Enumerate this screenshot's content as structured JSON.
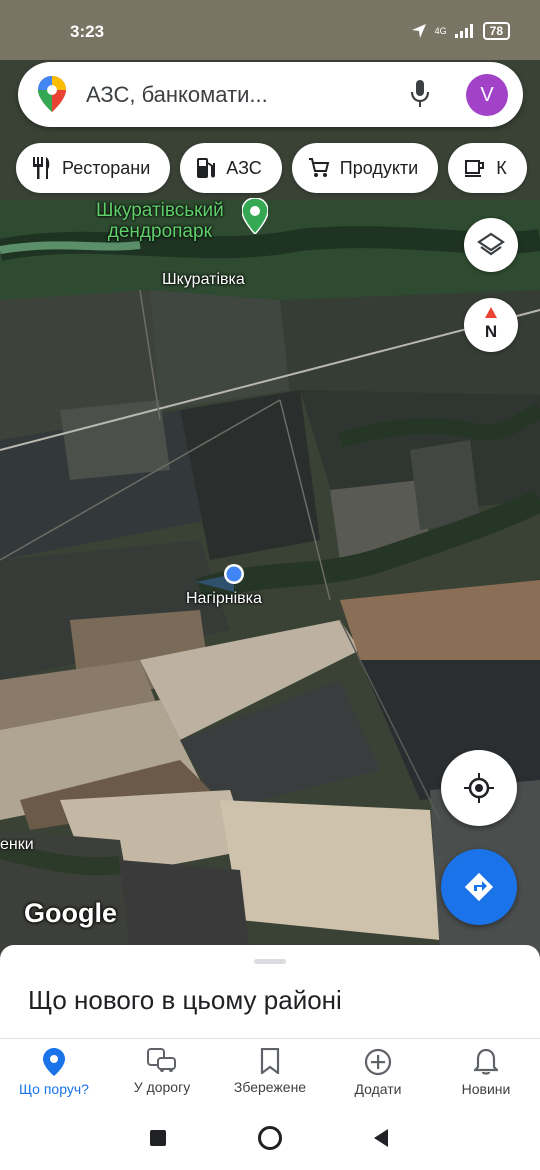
{
  "status": {
    "time": "3:23",
    "network": "4G",
    "battery": "78"
  },
  "search": {
    "placeholder": "АЗС, банкомати...",
    "avatar_letter": "V"
  },
  "chips": [
    {
      "label": "Ресторани",
      "icon": "restaurant-icon"
    },
    {
      "label": "АЗС",
      "icon": "gas-station-icon"
    },
    {
      "label": "Продукти",
      "icon": "shopping-cart-icon"
    },
    {
      "label": "К",
      "icon": "coffee-icon"
    }
  ],
  "map_labels": {
    "park_line1": "Шкуратівський",
    "park_line2": "дендропарк",
    "village1": "Шкуратівка",
    "village2": "Нагірнівка",
    "village3": "енки",
    "google": "Google"
  },
  "compass": {
    "label": "N"
  },
  "sheet": {
    "title": "Що нового в цьому районі"
  },
  "nav": [
    {
      "label": "Що поруч?",
      "icon": "location-pin-icon",
      "active": true
    },
    {
      "label": "У дорогу",
      "icon": "commute-icon",
      "active": false
    },
    {
      "label": "Збережене",
      "icon": "bookmark-icon",
      "active": false
    },
    {
      "label": "Додати",
      "icon": "add-circle-icon",
      "active": false
    },
    {
      "label": "Новини",
      "icon": "bell-icon",
      "active": false
    }
  ],
  "colors": {
    "accent": "#1a73e8",
    "avatar": "#a142c9",
    "park_green": "#5fd06a"
  }
}
